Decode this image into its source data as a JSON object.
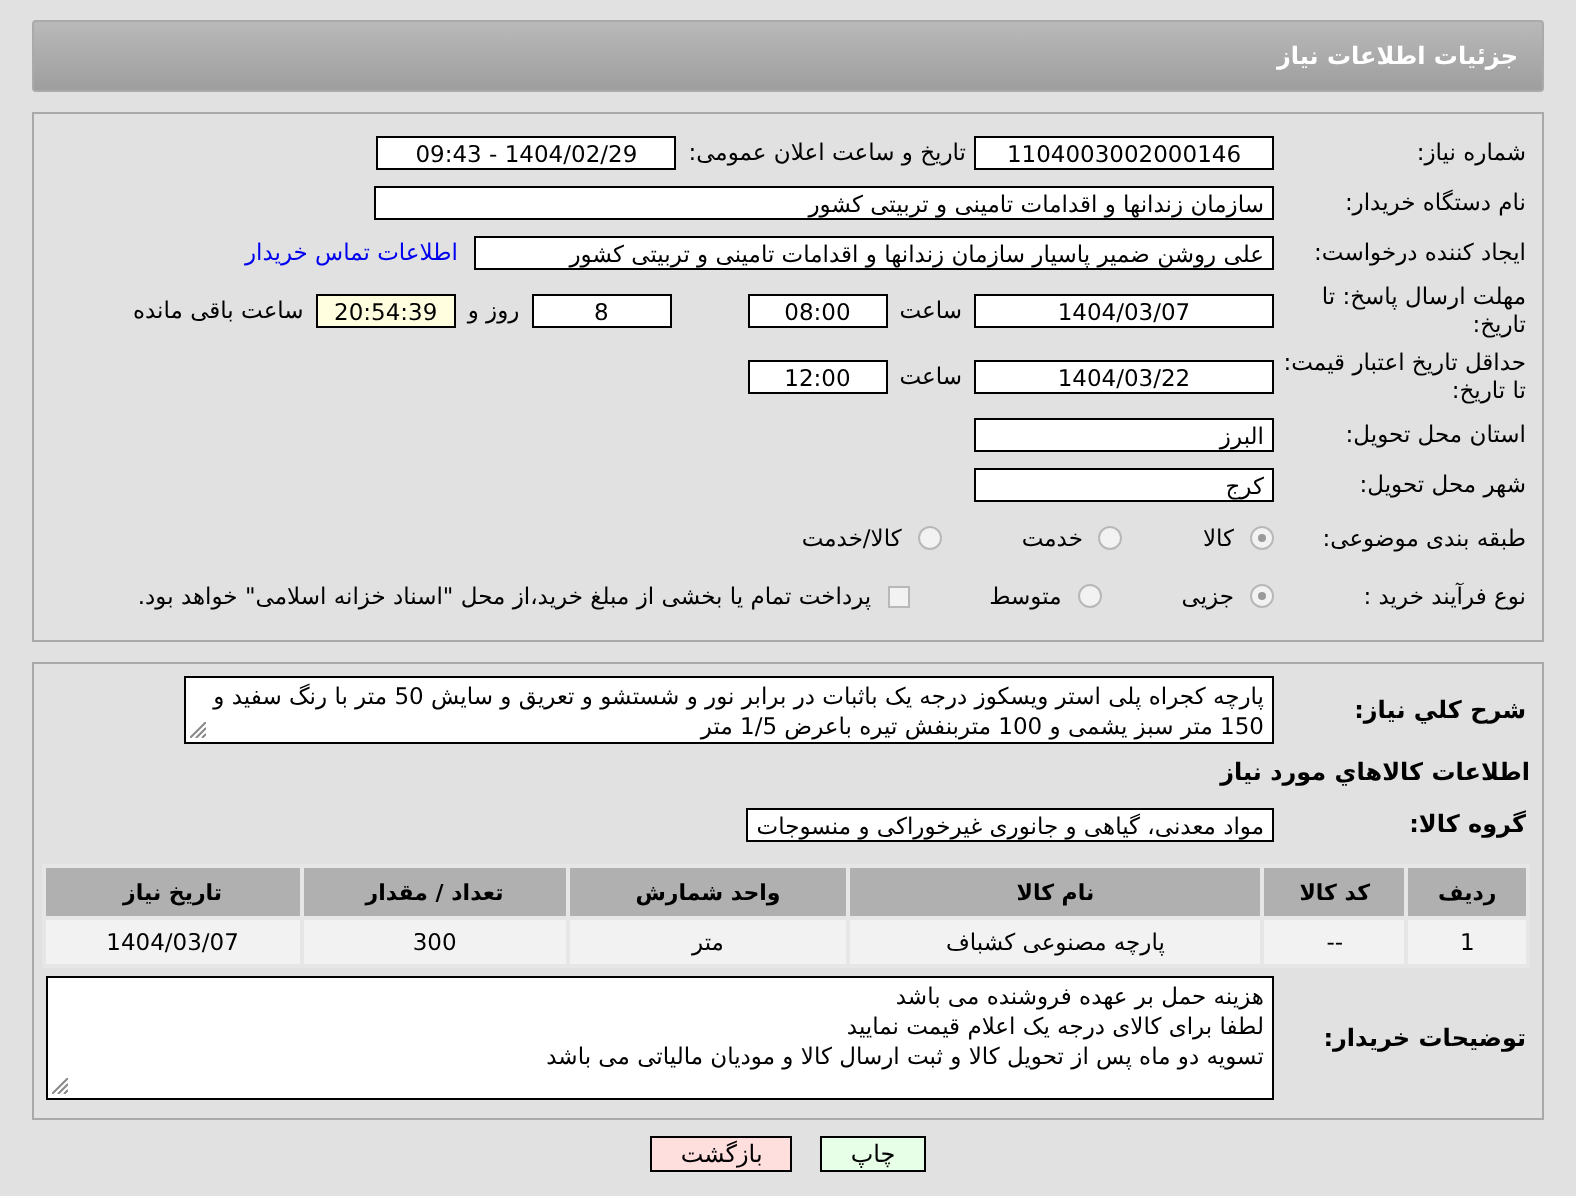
{
  "header": {
    "title": "جزئیات اطلاعات نیاز"
  },
  "need_number": {
    "label": "شماره نیاز:",
    "value": "1104003002000146"
  },
  "announce": {
    "label": "تاریخ و ساعت اعلان عمومی:",
    "value": "1404/02/29 - 09:43"
  },
  "buyer_org": {
    "label": "نام دستگاه خریدار:",
    "value": "سازمان زندانها و اقدامات تامینی و تربیتی کشور"
  },
  "requester": {
    "label": "ایجاد کننده درخواست:",
    "value": "علی روشن ضمیر پاسیار سازمان زندانها و اقدامات تامینی و تربیتی کشور",
    "link": "اطلاعات تماس خریدار"
  },
  "reply_deadline": {
    "label": "مهلت ارسال پاسخ: تا تاریخ:",
    "date": "1404/03/07",
    "time_label": "ساعت",
    "time": "08:00",
    "days": "8",
    "days_label": "روز و",
    "remaining": "20:54:39",
    "remaining_label": "ساعت باقی مانده"
  },
  "price_validity": {
    "label": "حداقل تاریخ اعتبار قیمت: تا تاریخ:",
    "date": "1404/03/22",
    "time_label": "ساعت",
    "time": "12:00"
  },
  "province": {
    "label": "استان محل تحویل:",
    "value": "البرز"
  },
  "city": {
    "label": "شهر محل تحویل:",
    "value": "کرج"
  },
  "category": {
    "label": "طبقه بندی موضوعی:",
    "options": [
      {
        "label": "کالا",
        "selected": true
      },
      {
        "label": "خدمت",
        "selected": false
      },
      {
        "label": "کالا/خدمت",
        "selected": false
      }
    ]
  },
  "purchase_process": {
    "label": "نوع فرآیند خرید :",
    "options": [
      {
        "label": "جزیی",
        "selected": true
      },
      {
        "label": "متوسط",
        "selected": false
      }
    ],
    "treasury": {
      "label": "پرداخت تمام یا بخشی از مبلغ خرید،از محل \"اسناد خزانه اسلامی\" خواهد بود.",
      "checked": false
    }
  },
  "description": {
    "label": "شرح کلي نياز:",
    "value": "پارچه کجراه پلی استر ویسکوز درجه یک باثبات در برابر نور و شستشو و تعریق و سایش 50 متر با رنگ سفید و 150 متر سبز یشمی و 100 متربنفش تیره باعرض 1/5 متر"
  },
  "goods_section": {
    "title": "اطلاعات كالاهاي مورد نياز"
  },
  "goods_group": {
    "label": "گروه کالا:",
    "value": "مواد معدنی، گیاهی و جانوری غیرخوراکی و منسوجات"
  },
  "table": {
    "columns": [
      "ردیف",
      "کد کالا",
      "نام کالا",
      "واحد شمارش",
      "تعداد / مقدار",
      "تاریخ نیاز"
    ],
    "rows": [
      [
        "1",
        "--",
        "پارچه مصنوعی کشباف",
        "متر",
        "300",
        "1404/03/07"
      ]
    ]
  },
  "buyer_notes": {
    "label": "توضیحات خریدار:",
    "lines": [
      "هزینه حمل بر عهده فروشنده می باشد",
      "لطفا برای کالای درجه یک اعلام قیمت نمایید",
      "تسویه دو ماه پس از تحویل کالا و ثبت ارسال کالا و مودیان مالیاتی می باشد"
    ]
  },
  "buttons": [
    {
      "label": "چاپ",
      "kind": "print"
    },
    {
      "label": "بازگشت",
      "kind": "back"
    }
  ]
}
